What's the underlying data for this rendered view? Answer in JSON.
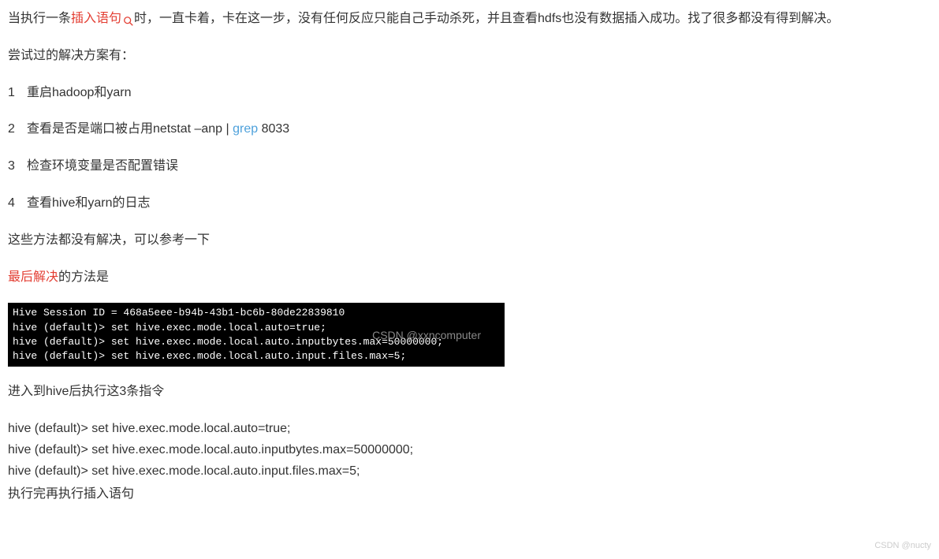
{
  "para1": {
    "prefix": "当执行一条",
    "highlight": "插入语句",
    "suffix": "时，一直卡着，卡在这一步，没有任何反应只能自己手动杀死，并且查看hdfs也没有数据插入成功。找了很多都没有得到解决。"
  },
  "para2": "尝试过的解决方案有：",
  "list": [
    {
      "num": "1",
      "text": "重启hadoop和yarn"
    },
    {
      "num": "2",
      "prefix": "查看是否是端口被占用netstat –anp | ",
      "link": "grep",
      "suffix": " 8033"
    },
    {
      "num": "3",
      "text": "检查环境变量是否配置错误"
    },
    {
      "num": "4",
      "text": "查看hive和yarn的日志"
    }
  ],
  "para3": "这些方法都没有解决，可以参考一下",
  "para4": {
    "highlight": "最后解决",
    "suffix": "的方法是"
  },
  "terminal": {
    "line1": "Hive Session ID = 468a5eee-b94b-43b1-bc6b-80de22839810",
    "line2": "hive (default)> set hive.exec.mode.local.auto=true;",
    "line3": "hive (default)> set hive.exec.mode.local.auto.inputbytes.max=50000000;",
    "line4": "hive (default)> set hive.exec.mode.local.auto.input.files.max=5;",
    "watermark": "CSDN @xxncomputer"
  },
  "para5": "进入到hive后执行这3条指令",
  "commands": [
    "hive (default)> set hive.exec.mode.local.auto=true;",
    "hive (default)> set hive.exec.mode.local.auto.inputbytes.max=50000000;",
    "hive (default)> set hive.exec.mode.local.auto.input.files.max=5;"
  ],
  "para6": "执行完再执行插入语句",
  "footerWatermark": "CSDN @nucty"
}
